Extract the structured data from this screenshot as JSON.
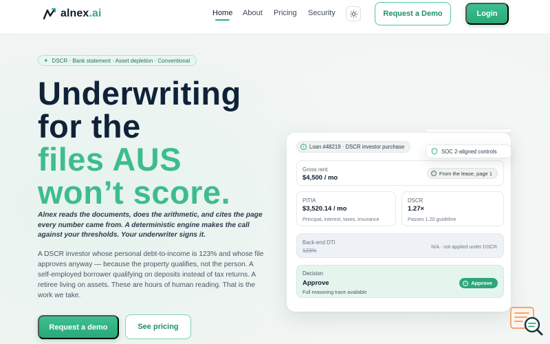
{
  "brand": {
    "name_main": "alnex",
    "name_suffix": ".ai",
    "accent": "#2fae7f",
    "dark": "#0f2238"
  },
  "nav": {
    "links": [
      "Home",
      "About",
      "Pricing",
      "Security"
    ],
    "active": "Home",
    "theme_icon": "sun-icon",
    "request_demo": "Request a Demo",
    "login": "Login"
  },
  "hero": {
    "pill": "DSCR · Bank statement · Asset depletion · Conventional",
    "headline_dark_1": "Underwriting",
    "headline_dark_2": "for the",
    "headline_green_1": "files AUS",
    "headline_green_2": "won’t score.",
    "lead": "Alnex reads the documents, does the arithmetic, and cites the page every number came from. A deterministic engine makes the call against your thresholds. Your underwriter signs it.",
    "body": "A DSCR investor whose personal debt-to-income is 123% and whose file approves anyway — because the property qualifies, not the person. A self-employed borrower qualifying on deposits instead of tax returns. A retiree living on assets. These are hours of human reading. That is the work we take.",
    "cta_primary": "Request a demo",
    "cta_secondary": "See pricing"
  },
  "card": {
    "loan": "Loan #48219 · DSCR investor purchase",
    "soc": "SOC 2-aligned controls",
    "gross_rent": {
      "label": "Gross rent",
      "value": "$4,500 / mo",
      "cite": "From the lease, page 1"
    },
    "pitia": {
      "label": "PITIA",
      "value": "$3,520.14 / mo",
      "sub": "Principal, interest, taxes, insurance"
    },
    "dscr": {
      "label": "DSCR",
      "value": "1.27×",
      "sub": "Passes 1.20 guideline"
    },
    "dti": {
      "label": "Back-end DTI",
      "value": "123%",
      "note": "N/A · not applied under DSCR"
    },
    "decision": {
      "label": "Decision",
      "value": "Approve",
      "sub": "Full reasoning trace available",
      "chip": "Approve"
    }
  }
}
